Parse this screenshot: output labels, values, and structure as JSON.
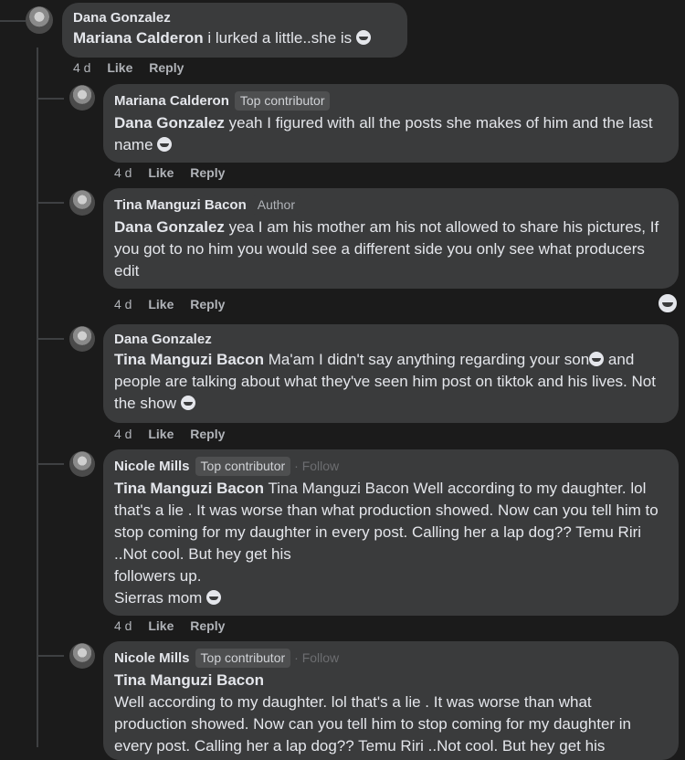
{
  "comments": [
    {
      "author": "Dana Gonzalez",
      "mention": "Mariana Calderon",
      "text": " i lurked a little..she is ",
      "time": "4 d",
      "like": "Like",
      "reply": "Reply"
    },
    {
      "author": "Mariana Calderon",
      "badge": "Top contributor",
      "mention": "Dana Gonzalez",
      "text": " yeah I figured with all the posts she makes of him and the last name ",
      "time": "4 d",
      "like": "Like",
      "reply": "Reply"
    },
    {
      "author": "Tina Manguzi Bacon",
      "badge": "Author",
      "mention": "Dana Gonzalez",
      "text": " yea I am his mother am his not allowed to share his pictures, If you got to no him you would see a different side you only see what producers edit",
      "time": "4 d",
      "like": "Like",
      "reply": "Reply"
    },
    {
      "author": "Dana Gonzalez",
      "mention": "Tina Manguzi Bacon",
      "text": " Ma'am I didn't say anything regarding your son",
      "text2": " and people are talking about what they've seen him post on tiktok and his lives. Not the show ",
      "time": "4 d",
      "like": "Like",
      "reply": "Reply"
    },
    {
      "author": "Nicole Mills",
      "badge": "Top contributor",
      "follow": "· Follow",
      "mention": "Tina Manguzi Bacon",
      "text": " Tina Manguzi Bacon Well according to my daughter. lol that's a lie . It was worse than what production showed. Now can you tell him to stop coming for my daughter in every post. Calling her a lap dog?? Temu Riri ..Not cool. But hey get his\nfollowers up.\nSierras mom ",
      "time": "4 d",
      "like": "Like",
      "reply": "Reply"
    },
    {
      "author": "Nicole Mills",
      "badge": "Top contributor",
      "follow": "· Follow",
      "mention": "Tina Manguzi Bacon",
      "text": "Well according to my daughter. lol that's a lie . It was worse than what production showed. Now can you tell him to stop coming for my daughter in every post. Calling her a lap dog?? Temu Riri ..Not cool. But hey get his"
    }
  ]
}
